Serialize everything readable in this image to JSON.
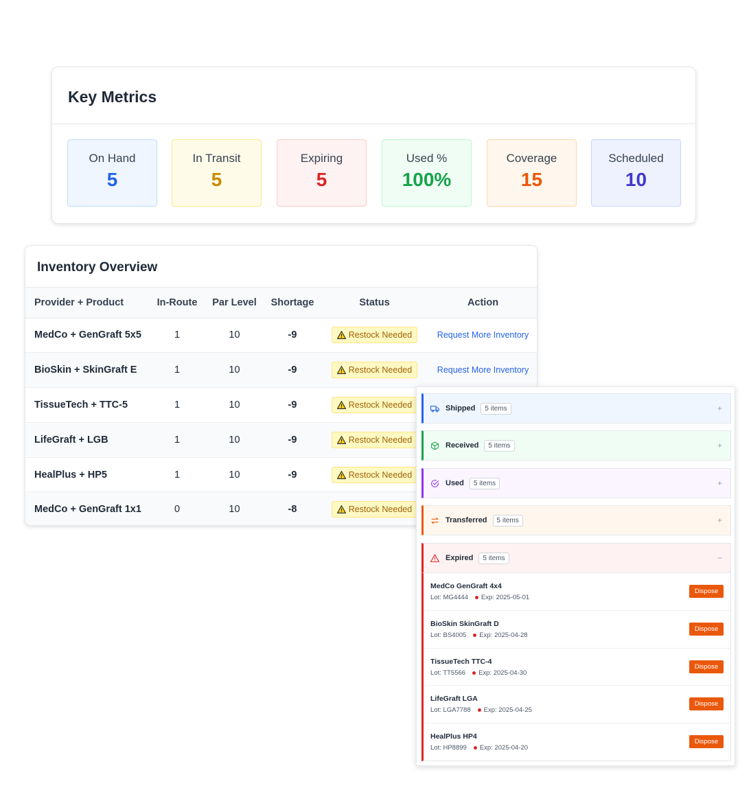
{
  "metrics": {
    "title": "Key Metrics",
    "tiles": [
      {
        "label": "On Hand",
        "value": "5",
        "bg": "#eff6ff",
        "border": "#bfdbfe",
        "color": "#2563eb"
      },
      {
        "label": "In Transit",
        "value": "5",
        "bg": "#fefce8",
        "border": "#fde68a",
        "color": "#ca8a04"
      },
      {
        "label": "Expiring",
        "value": "5",
        "bg": "#fef2f2",
        "border": "#fecaca",
        "color": "#dc2626"
      },
      {
        "label": "Used %",
        "value": "100%",
        "bg": "#f0fdf4",
        "border": "#bbf7d0",
        "color": "#16a34a"
      },
      {
        "label": "Coverage",
        "value": "15",
        "bg": "#fff7ed",
        "border": "#fed7aa",
        "color": "#ea580c"
      },
      {
        "label": "Scheduled",
        "value": "10",
        "bg": "#eef2ff",
        "border": "#c7d2fe",
        "color": "#4338ca"
      }
    ]
  },
  "inventory": {
    "title": "Inventory Overview",
    "columns": [
      "Provider + Product",
      "In-Route",
      "Par Level",
      "Shortage",
      "Status",
      "Action"
    ],
    "rows": [
      {
        "product": "MedCo + GenGraft 5x5",
        "in_route": "1",
        "par": "10",
        "shortage": "-9",
        "status": "Restock Needed",
        "action": "Request More Inventory"
      },
      {
        "product": "BioSkin + SkinGraft E",
        "in_route": "1",
        "par": "10",
        "shortage": "-9",
        "status": "Restock Needed",
        "action": "Request More Inventory"
      },
      {
        "product": "TissueTech + TTC-5",
        "in_route": "1",
        "par": "10",
        "shortage": "-9",
        "status": "Restock Needed",
        "action": ""
      },
      {
        "product": "LifeGraft + LGB",
        "in_route": "1",
        "par": "10",
        "shortage": "-9",
        "status": "Restock Needed",
        "action": ""
      },
      {
        "product": "HealPlus + HP5",
        "in_route": "1",
        "par": "10",
        "shortage": "-9",
        "status": "Restock Needed",
        "action": ""
      },
      {
        "product": "MedCo + GenGraft 1x1",
        "in_route": "0",
        "par": "10",
        "shortage": "-8",
        "status": "Restock Needed",
        "action": ""
      }
    ],
    "warning_icon": "warning-triangle-icon"
  },
  "status_panel": {
    "groups": [
      {
        "label": "Shipped",
        "count": "5 items",
        "icon": "truck-icon",
        "color": "#2563eb",
        "bg": "#eff6ff",
        "toggle": "+"
      },
      {
        "label": "Received",
        "count": "5 items",
        "icon": "package-icon",
        "color": "#16a34a",
        "bg": "#f0fdf4",
        "toggle": "+"
      },
      {
        "label": "Used",
        "count": "5 items",
        "icon": "check-circle-icon",
        "color": "#9333ea",
        "bg": "#faf5ff",
        "toggle": "+"
      },
      {
        "label": "Transferred",
        "count": "5 items",
        "icon": "arrows-exchange-icon",
        "color": "#ea580c",
        "bg": "#fff7ed",
        "toggle": "+"
      },
      {
        "label": "Expired",
        "count": "5 items",
        "icon": "alert-triangle-icon",
        "color": "#dc2626",
        "bg": "#fef2f2",
        "toggle": "−"
      }
    ],
    "expired_items": [
      {
        "name": "MedCo GenGraft 4x4",
        "lot": "Lot: MG4444",
        "exp": "Exp: 2025-05-01",
        "button": "Dispose"
      },
      {
        "name": "BioSkin SkinGraft D",
        "lot": "Lot: BS4005",
        "exp": "Exp: 2025-04-28",
        "button": "Dispose"
      },
      {
        "name": "TissueTech TTC-4",
        "lot": "Lot: TT5566",
        "exp": "Exp: 2025-04-30",
        "button": "Dispose"
      },
      {
        "name": "LifeGraft LGA",
        "lot": "Lot: LGA7788",
        "exp": "Exp: 2025-04-25",
        "button": "Dispose"
      },
      {
        "name": "HealPlus HP4",
        "lot": "Lot: HP8899",
        "exp": "Exp: 2025-04-20",
        "button": "Dispose"
      }
    ]
  }
}
